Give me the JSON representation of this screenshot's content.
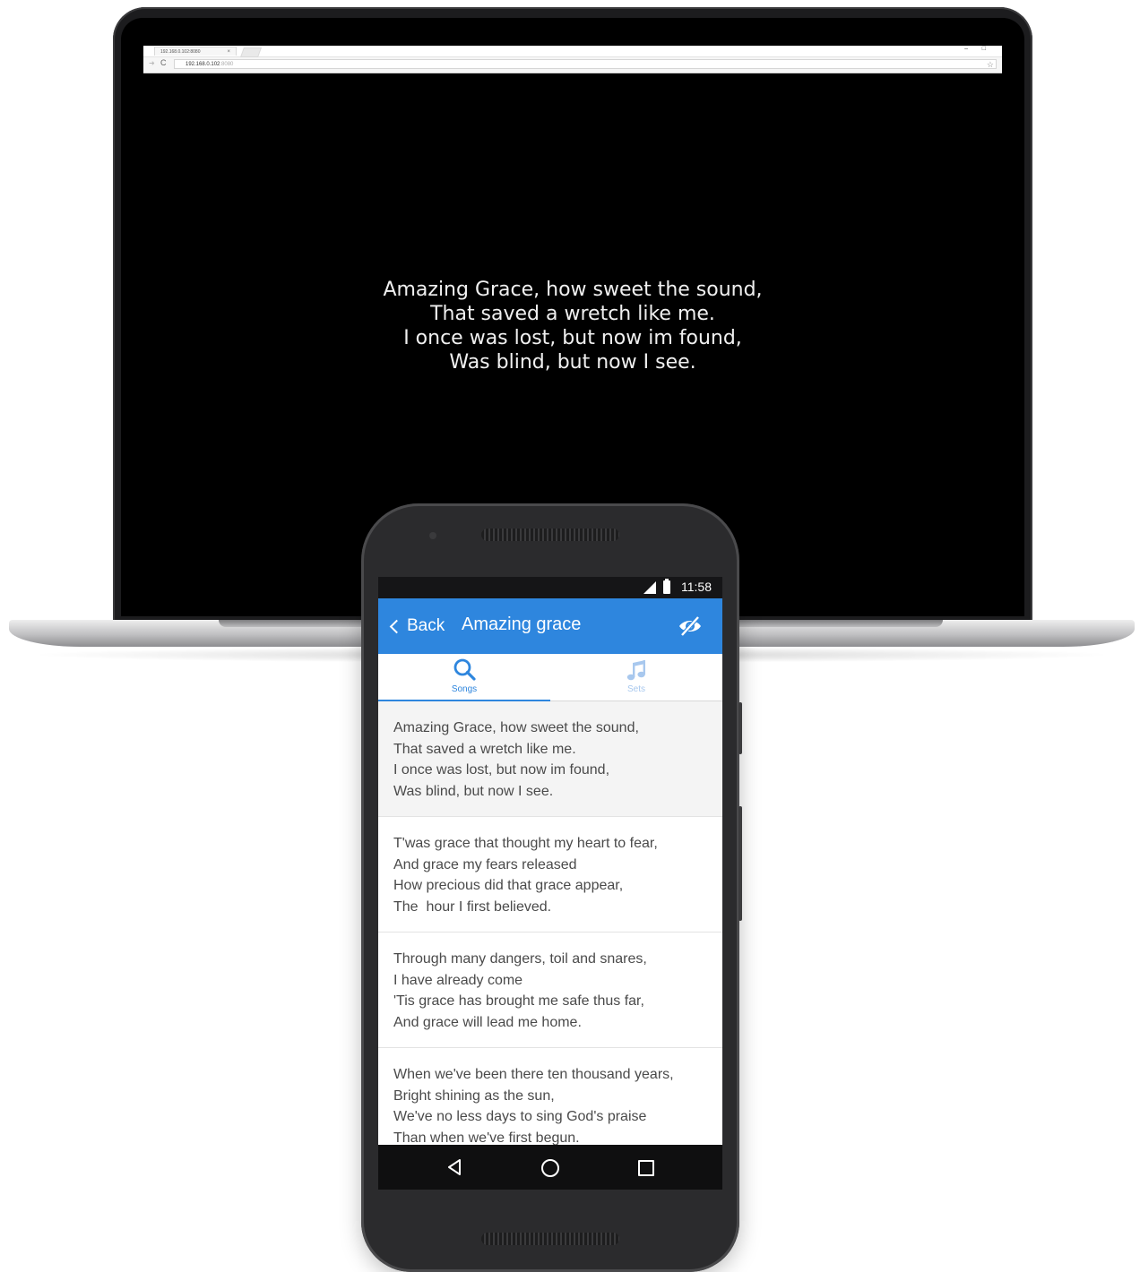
{
  "browser": {
    "tab_title": "192.168.0.102:8080",
    "tab_close": "×",
    "url_host": "192.168.0.102",
    "url_port": ":8080",
    "minimize": "–",
    "maximize": "□"
  },
  "projection": {
    "lines": [
      "Amazing Grace, how sweet the sound,",
      "That saved a wretch like me.",
      "I once was lost, but now im found,",
      "Was blind, but now I see."
    ]
  },
  "phone": {
    "status_time": "11:58",
    "app_bar": {
      "back_label": "Back",
      "title": "Amazing grace",
      "action_icon": "eye-off-icon"
    },
    "tabs": [
      {
        "label": "Songs",
        "icon": "search-icon",
        "active": true
      },
      {
        "label": "Sets",
        "icon": "music-note-icon",
        "active": false
      }
    ],
    "verses": [
      {
        "lines": [
          "Amazing Grace, how sweet the sound,",
          "That saved a wretch like me.",
          "I once was lost, but now im found,",
          "Was blind, but now I see."
        ]
      },
      {
        "lines": [
          "T'was grace that thought my heart to fear,",
          "And grace my fears released",
          "How precious did that grace appear,",
          "The  hour I first believed."
        ]
      },
      {
        "lines": [
          "Through many dangers, toil and snares,",
          "I have already come",
          "'Tis grace has brought me safe thus far,",
          "And grace will lead me home."
        ]
      },
      {
        "lines": [
          "When we've been there ten thousand years,",
          "Bright shining as the sun,",
          "We've no less days to sing God's praise",
          "Than when we've first begun."
        ]
      }
    ],
    "colors": {
      "accent": "#2e86de",
      "active_verse_bg": "#f4f4f4"
    }
  }
}
